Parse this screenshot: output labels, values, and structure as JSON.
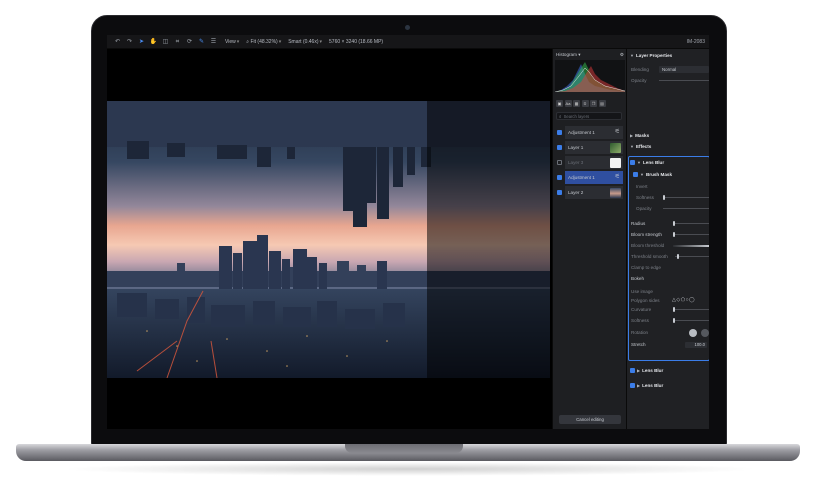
{
  "toolbar": {
    "view_label": "View",
    "zoom_label": "Fit (48.32%)",
    "smart_label": "Smart (0.46x)",
    "dimensions_label": "5760 × 3240 (18.66 MP)",
    "right_label": "IM-2083"
  },
  "histogram": {
    "label": "Histogram"
  },
  "layers_panel": {
    "search_placeholder": "Search layers",
    "tool_icons": [
      "image-icon",
      "text-icon",
      "grid-icon",
      "adjust-icon",
      "layers-icon",
      "delete-icon"
    ],
    "layers": [
      {
        "name": "Adjustment 1",
        "visible": true,
        "selected": false,
        "thumb": "adjust"
      },
      {
        "name": "Layer 1",
        "visible": true,
        "selected": false,
        "thumb": "mask"
      },
      {
        "name": "Layer 3",
        "visible": false,
        "selected": false,
        "thumb": "white"
      },
      {
        "name": "Adjustment 1",
        "visible": true,
        "selected": true,
        "thumb": "adjust"
      },
      {
        "name": "Layer 2",
        "visible": true,
        "selected": false,
        "thumb": "photo"
      }
    ],
    "cancel_label": "Cancel editing"
  },
  "properties": {
    "title": "Layer Properties",
    "blending_label": "Blending",
    "blending_value": "Normal",
    "opacity_label": "Opacity",
    "masks_label": "Masks",
    "effects_label": "Effects",
    "effect_title": "Lens Blur",
    "brush_mask_label": "Brush Mask",
    "invert_label": "Invert",
    "softness_label": "Softness",
    "mask_opacity_label": "Opacity",
    "radius_label": "Radius",
    "bloom_strength_label": "Bloom strength",
    "bloom_threshold_label": "Bloom threshold",
    "threshold_smooth_label": "Threshold smooth",
    "clamp_label": "Clamp to edge",
    "bokeh_label": "Bokeh",
    "use_image_label": "Use image",
    "polygon_sides_label": "Polygon sides",
    "polygon_shapes": "△◇⬠○◯",
    "curvature_label": "Curvature",
    "bokeh_softness_label": "Softness",
    "rotation_label": "Rotation",
    "stretch_label": "Stretch",
    "stretch_value": "100.0",
    "extra_effects": [
      "Lens Blur",
      "Lens Blur"
    ]
  },
  "colors": {
    "accent": "#3b7de8",
    "selected_layer": "#2f4fa0"
  }
}
